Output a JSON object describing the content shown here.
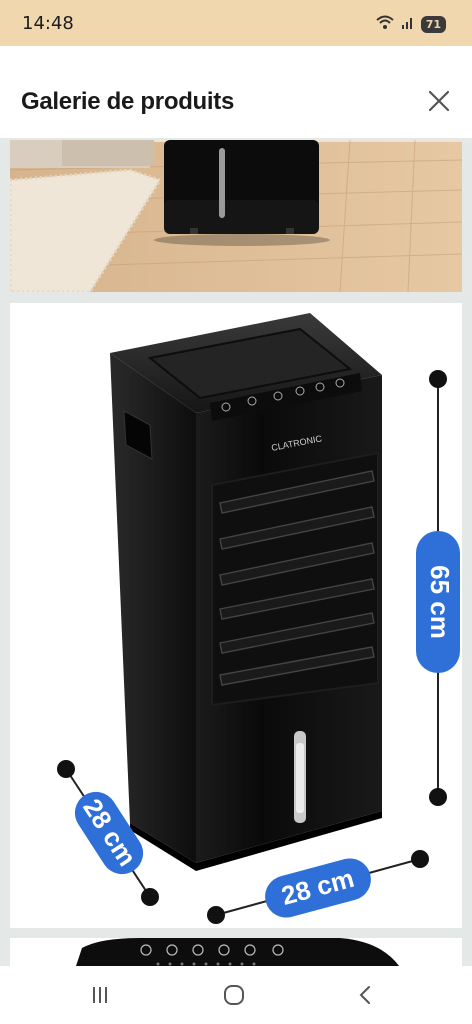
{
  "status_bar": {
    "time": "14:48",
    "battery": "71",
    "icons": [
      "wifi-icon",
      "signal-icon",
      "battery-icon"
    ]
  },
  "header": {
    "title": "Galerie de produits",
    "close_icon": "close-icon"
  },
  "gallery": {
    "images": [
      {
        "name": "product-photo-room"
      },
      {
        "name": "product-photo-dimensions",
        "height_label": "65 cm",
        "width_label": "28 cm",
        "depth_label": "28 cm",
        "brand": "CLATRONIC"
      },
      {
        "name": "product-photo-control-panel"
      }
    ]
  },
  "nav_bar": {
    "items": [
      "recent-apps-icon",
      "home-icon",
      "back-icon"
    ]
  },
  "colors": {
    "status_bar": "#f0d7ad",
    "badge_blue": "#2e6fd8",
    "product_black": "#111111",
    "gallery_bg": "#e4e8e6"
  }
}
